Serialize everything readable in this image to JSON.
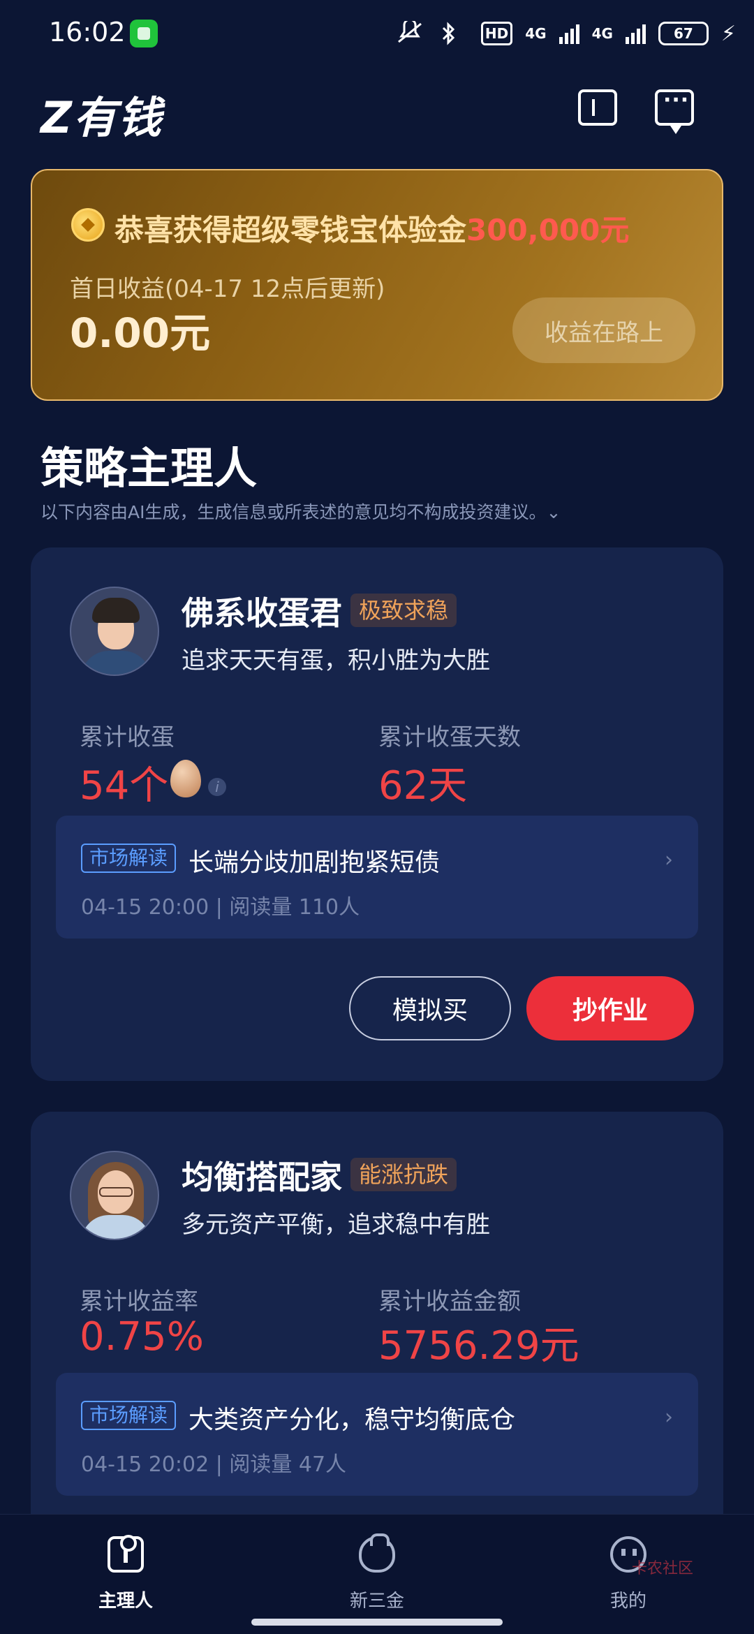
{
  "status_bar": {
    "time": "16:02",
    "hd_label": "HD",
    "network_1": "4G",
    "network_2": "4G",
    "battery": "67"
  },
  "header": {
    "brand": "Z有钱",
    "icons": [
      "ticket-icon",
      "message-icon"
    ]
  },
  "banner": {
    "title_prefix": "恭喜获得超级零钱宝体验金",
    "title_amount": "300,000元",
    "subtitle": "首日收益(04-17 12点后更新)",
    "amount": "0.00元",
    "button_label": "收益在路上"
  },
  "section": {
    "title": "策略主理人",
    "disclaimer": "以下内容由AI生成，生成信息或所表述的意见均不构成投资建议。⌄"
  },
  "managers": [
    {
      "name": "佛系收蛋君",
      "tag": "极致求稳",
      "motto": "追求天天有蛋，积小胜为大胜",
      "stat1_label": "累计收蛋",
      "stat1_value": "54个",
      "stat2_label": "累计收蛋天数",
      "stat2_value": "62天",
      "news_badge": "市场解读",
      "news_title": "长端分歧加剧抱紧短债",
      "news_meta": "04-15 20:00 | 阅读量 110人",
      "btn_simulate": "模拟买",
      "btn_copy": "抄作业"
    },
    {
      "name": "均衡搭配家",
      "tag": "能涨抗跌",
      "motto": "多元资产平衡，追求稳中有胜",
      "stat1_label": "累计收益率",
      "stat1_value": "0.75%",
      "stat2_label": "累计收益金额",
      "stat2_value": "5756.29元",
      "news_badge": "市场解读",
      "news_title": "大类资产分化，稳守均衡底仓",
      "news_meta": "04-15 20:02 | 阅读量 47人"
    }
  ],
  "tabbar": {
    "tabs": [
      {
        "label": "主理人",
        "icon": "manager-icon",
        "active": true
      },
      {
        "label": "新三金",
        "icon": "ingot-icon",
        "active": false
      },
      {
        "label": "我的",
        "icon": "profile-face-icon",
        "active": false
      }
    ]
  },
  "watermark": "卡农社区",
  "colors": {
    "background": "#0c1634",
    "card": "#16244b",
    "accent_red": "#ec2f3a",
    "value_red": "#f04446",
    "gold_text": "#ffe2a8",
    "tag_orange": "#f0a35a",
    "badge_blue": "#5b9dff"
  }
}
